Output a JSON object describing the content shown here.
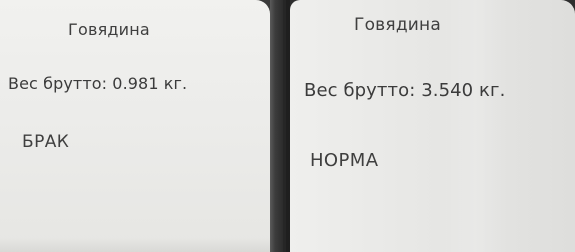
{
  "panels": [
    {
      "title": "Говядина",
      "weight_text": "Вес брутто: 0.981 кг.",
      "status": "БРАК"
    },
    {
      "title": "Говядина",
      "weight_text": "Вес брутто: 3.540 кг.",
      "status": "НОРМА"
    }
  ]
}
